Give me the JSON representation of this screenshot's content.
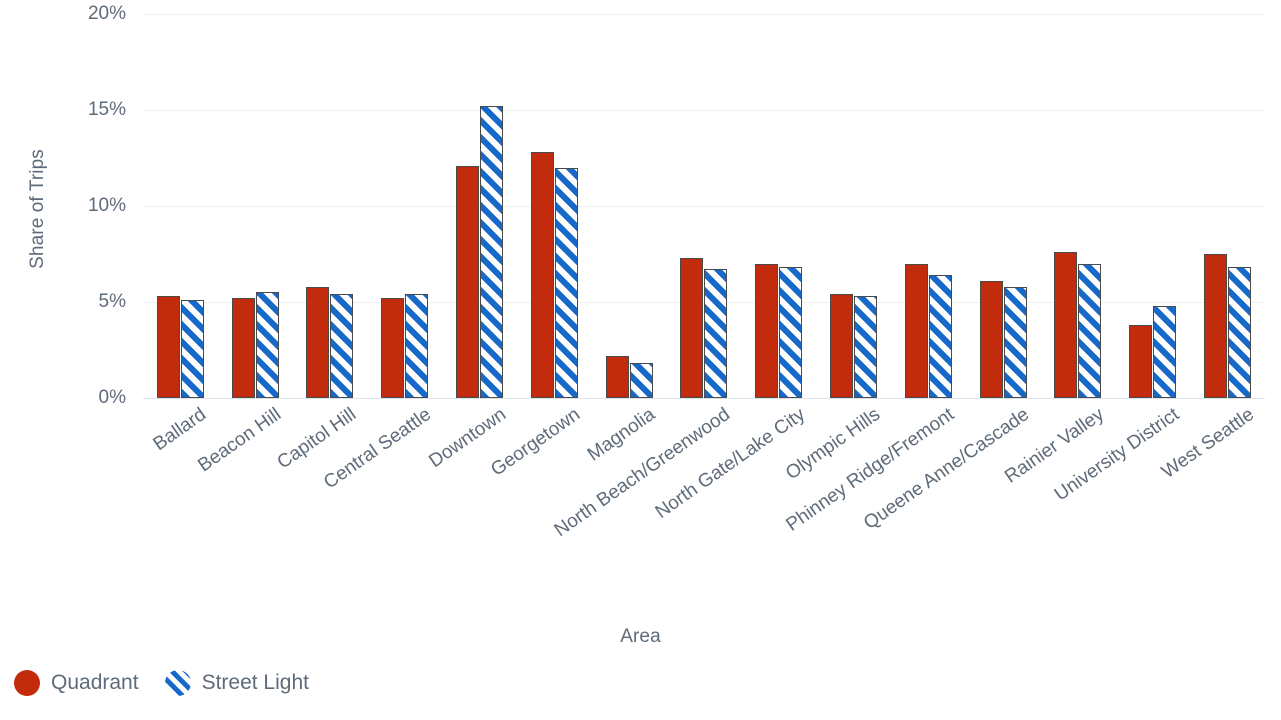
{
  "chart_data": {
    "type": "bar",
    "title": "",
    "xlabel": "Area",
    "ylabel": "Share of Trips",
    "ylim": [
      0,
      20
    ],
    "ytick_labels": [
      "0%",
      "5%",
      "10%",
      "15%",
      "20%"
    ],
    "ytick_values": [
      0,
      5,
      10,
      15,
      20
    ],
    "grid": true,
    "legend_position": "bottom-left",
    "value_unit": "percent",
    "categories": [
      "Ballard",
      "Beacon Hill",
      "Capitol Hill",
      "Central Seattle",
      "Downtown",
      "Georgetown",
      "Magnolia",
      "North Beach/Greenwood",
      "North Gate/Lake City",
      "Olympic Hills",
      "Phinney Ridge/Fremont",
      "Queene Anne/Cascade",
      "Rainier Valley",
      "University District",
      "West Seattle"
    ],
    "series": [
      {
        "name": "Quadrant",
        "color": "#c32b0d",
        "pattern": "solid",
        "values": [
          5.3,
          5.2,
          5.8,
          5.2,
          12.1,
          12.8,
          2.2,
          7.3,
          7.0,
          5.4,
          7.0,
          6.1,
          7.6,
          3.8,
          7.5
        ]
      },
      {
        "name": "Street Light",
        "color": "#1669c8",
        "pattern": "diagonal-hatch",
        "values": [
          5.1,
          5.5,
          5.4,
          5.4,
          15.2,
          12.0,
          1.8,
          6.7,
          6.8,
          5.3,
          6.4,
          5.8,
          7.0,
          4.8,
          6.8
        ]
      }
    ]
  },
  "legend": {
    "items": [
      {
        "label": "Quadrant",
        "marker": "filled-circle-icon"
      },
      {
        "label": "Street Light",
        "marker": "hatched-circle-icon"
      }
    ]
  }
}
